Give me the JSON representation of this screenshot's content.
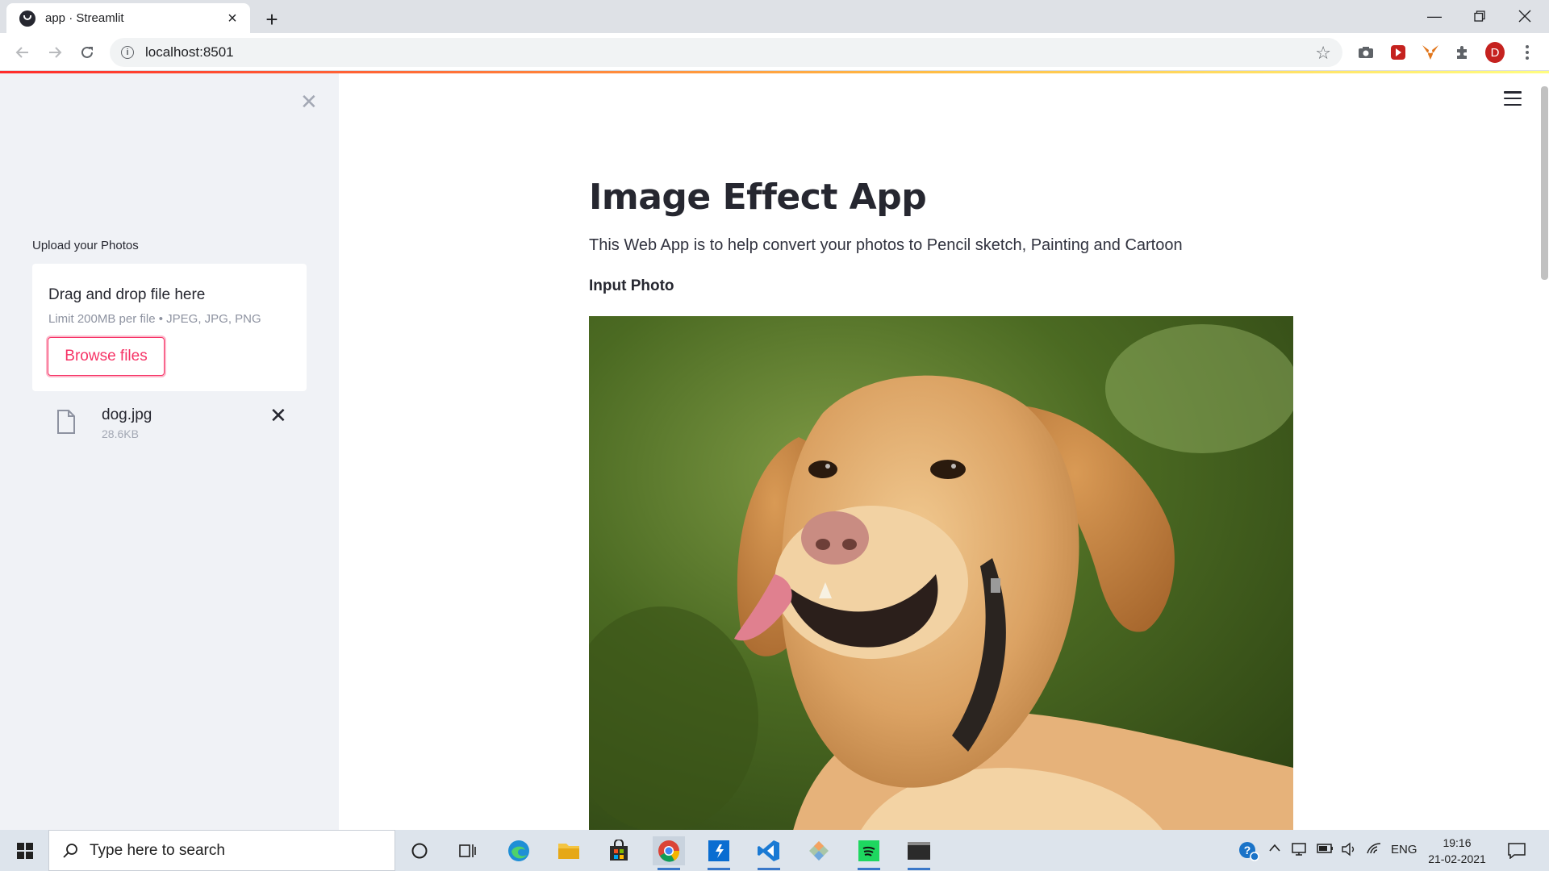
{
  "browser": {
    "tab_title": "app · Streamlit",
    "url": "localhost:8501",
    "profile_initial": "D"
  },
  "sidebar": {
    "uploader_label": "Upload your Photos",
    "dropzone_title": "Drag and drop file here",
    "dropzone_limit": "Limit 200MB per file • JPEG, JPG, PNG",
    "browse_label": "Browse files",
    "file": {
      "name": "dog.jpg",
      "size": "28.6KB"
    }
  },
  "main": {
    "title": "Image Effect App",
    "description": "This Web App is to help convert your photos to Pencil sketch, Painting and Cartoon",
    "input_label": "Input Photo"
  },
  "taskbar": {
    "search_placeholder": "Type here to search",
    "language": "ENG",
    "time": "19:16",
    "date": "21-02-2021"
  },
  "colors": {
    "accent": "#f63366",
    "sidebar_bg": "#f0f2f6",
    "text": "#262730"
  }
}
